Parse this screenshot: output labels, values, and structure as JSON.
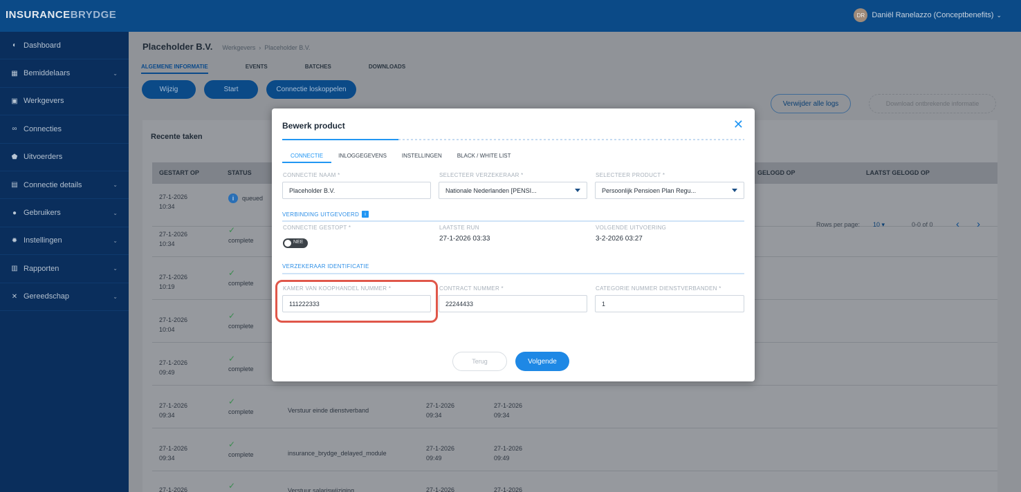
{
  "app": {
    "logo_part1": "INSURANCE",
    "logo_part2": "BRYDGE",
    "user_initials": "DR",
    "user_name": "Daniël Ranelazzo (Conceptbenefits)"
  },
  "sidebar": {
    "items": [
      {
        "label": "Dashboard",
        "icon": "dashboard-icon",
        "glyph": "◐",
        "expandable": false
      },
      {
        "label": "Bemiddelaars",
        "icon": "building-icon",
        "glyph": "▦",
        "expandable": true
      },
      {
        "label": "Werkgevers",
        "icon": "briefcase-icon",
        "glyph": "▣",
        "expandable": false
      },
      {
        "label": "Connecties",
        "icon": "link-icon",
        "glyph": "∞",
        "expandable": false
      },
      {
        "label": "Uitvoerders",
        "icon": "shield-icon",
        "glyph": "⬟",
        "expandable": false
      },
      {
        "label": "Connectie details",
        "icon": "lock-icon",
        "glyph": "▤",
        "expandable": true
      },
      {
        "label": "Gebruikers",
        "icon": "user-icon",
        "glyph": "●",
        "expandable": true
      },
      {
        "label": "Instellingen",
        "icon": "gear-icon",
        "glyph": "✹",
        "expandable": true
      },
      {
        "label": "Rapporten",
        "icon": "chart-icon",
        "glyph": "▥",
        "expandable": true
      },
      {
        "label": "Gereedschap",
        "icon": "tools-icon",
        "glyph": "✕",
        "expandable": true
      }
    ]
  },
  "page": {
    "title": "Placeholder B.V.",
    "breadcrumb": [
      "Werkgevers",
      "Placeholder B.V."
    ],
    "breadcrumb_sep": "›",
    "tabs": [
      "ALGEMENE INFORMATIE",
      "EVENTS",
      "BATCHES",
      "DOWNLOADS"
    ],
    "buttons": {
      "edit": "Wijzig",
      "start": "Start",
      "disconnect": "Connectie loskoppelen"
    }
  },
  "tasks": {
    "title": "Recente taken",
    "delete_logs": "Verwijder alle logs",
    "download": "Download ontbrekende informatie",
    "columns": [
      "GESTART OP",
      "STATUS",
      "GELOGD OP",
      "LAATST GELOGD OP"
    ],
    "rows": [
      {
        "date": "27-1-2026",
        "time": "10:34",
        "status": "queued",
        "task": "",
        "d1": "",
        "t1": "",
        "d2": "",
        "t2": ""
      },
      {
        "date": "27-1-2026",
        "time": "10:34",
        "status": "complete",
        "task": "",
        "d1": "",
        "t1": "",
        "d2": "",
        "t2": ""
      },
      {
        "date": "27-1-2026",
        "time": "10:19",
        "status": "complete",
        "task": "",
        "d1": "",
        "t1": "",
        "d2": "",
        "t2": ""
      },
      {
        "date": "27-1-2026",
        "time": "10:04",
        "status": "complete",
        "task": "",
        "d1": "",
        "t1": "",
        "d2": "",
        "t2": ""
      },
      {
        "date": "27-1-2026",
        "time": "09:49",
        "status": "complete",
        "task": "",
        "d1": "",
        "t1": "",
        "d2": "",
        "t2": ""
      },
      {
        "date": "27-1-2026",
        "time": "09:34",
        "status": "complete",
        "task": "Verstuur einde dienstverband",
        "d1": "27-1-2026",
        "t1": "09:34",
        "d2": "27-1-2026",
        "t2": "09:34"
      },
      {
        "date": "27-1-2026",
        "time": "09:34",
        "status": "complete",
        "task": "insurance_brydge_delayed_module",
        "d1": "27-1-2026",
        "t1": "09:49",
        "d2": "27-1-2026",
        "t2": "09:49"
      },
      {
        "date": "27-1-2026",
        "time": "",
        "status": "",
        "task": "Verstuur salariswijziging",
        "d1": "27-1-2026",
        "t1": "",
        "d2": "27-1-2026",
        "t2": ""
      }
    ],
    "pager": {
      "rows_per_page_label": "Rows per page:",
      "rows_per_page": "10",
      "range": "0-0 of 0",
      "prev": "‹",
      "next": "›"
    }
  },
  "modal": {
    "title": "Bewerk product",
    "close": "✕",
    "tabs": [
      "CONNECTIE",
      "INLOGGEGEVENS",
      "INSTELLINGEN",
      "BLACK / WHITE LIST"
    ],
    "fields": {
      "connection_name": {
        "label": "CONNECTIE NAAM *",
        "value": "Placeholder B.V."
      },
      "insurer": {
        "label": "SELECTEER VERZEKERAAR *",
        "value": "Nationale Nederlanden [PENSI..."
      },
      "product": {
        "label": "SELECTEER PRODUCT *",
        "value": "Persoonlijk Pensioen Plan Regu..."
      }
    },
    "section_run": "VERBINDING UITGEVOERD",
    "info_badge": "i",
    "run": {
      "stopped_label": "CONNECTIE GESTOPT *",
      "toggle_text": "NEE",
      "toggle_on": false,
      "last_run_label": "LAATSTE RUN",
      "last_run": "27-1-2026 03:33",
      "next_run_label": "VOLGENDE UITVOERING",
      "next_run": "3-2-2026 03:27"
    },
    "section_ident": "VERZEKERAAR IDENTIFICATIE",
    "ident": {
      "kvk_label": "KAMER VAN KOOPHANDEL NUMMER *",
      "kvk": "111222333",
      "contract_label": "CONTRACT NUMMER *",
      "contract": "22244433",
      "category_label": "CATEGORIE NUMMER DIENSTVERBANDEN *",
      "category": "1"
    },
    "back": "Terug",
    "next": "Volgende"
  },
  "colors": {
    "accent": "#2196f3",
    "highlight": "#e0574a",
    "topbar": "#0b4a87",
    "sidebar": "#0a2e5c"
  }
}
